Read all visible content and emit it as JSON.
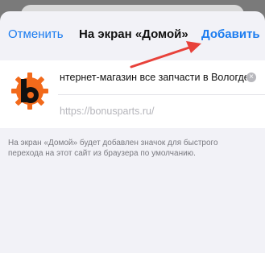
{
  "nav": {
    "cancel_label": "Отменить",
    "title": "На экран «Домой»",
    "add_label": "Добавить"
  },
  "shortcut": {
    "name_value": "нтернет-магазин все запчасти в Вологде",
    "url": "https://bonusparts.ru/",
    "icon": "bonusparts-logo-icon"
  },
  "footnote": "На экран «Домой» будет добавлен значок для быстрого перехода на этот сайт из браузера по умолчанию.",
  "colors": {
    "accent": "#1b7cf0",
    "annotation_arrow": "#e8413a",
    "logo_orange": "#f26a1b"
  }
}
